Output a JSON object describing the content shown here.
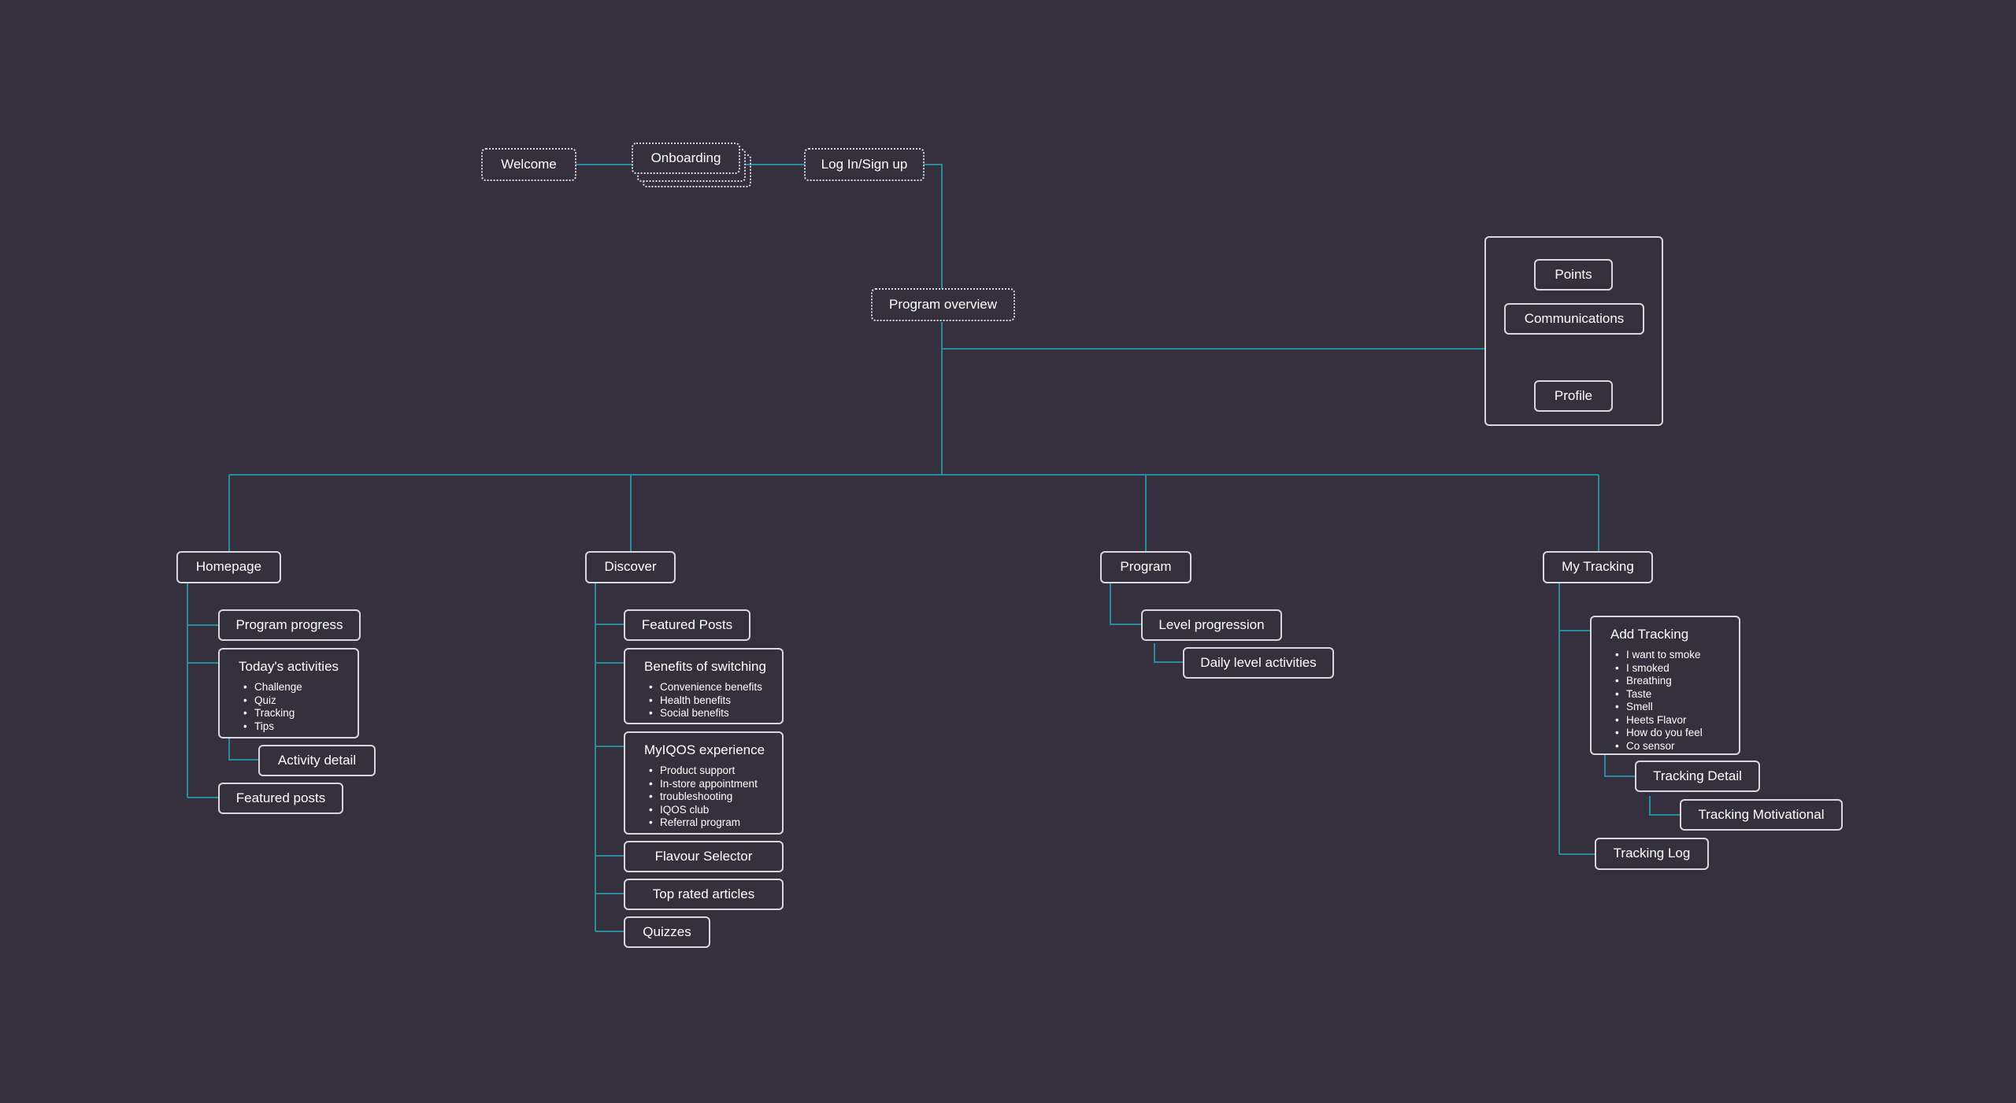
{
  "colors": {
    "background": "#35303d",
    "connector": "#2b8a9e",
    "node_border": "#dad6df",
    "text": "#ffffff"
  },
  "flow": {
    "welcome": "Welcome",
    "onboarding": "Onboarding",
    "login": "Log In/Sign up",
    "program_overview": "Program overview"
  },
  "global": {
    "points": "Points",
    "communications": "Communications",
    "profile": "Profile"
  },
  "homepage": {
    "title": "Homepage",
    "program_progress": "Program progress",
    "todays_activities": {
      "title": "Today's activities",
      "items": [
        "Challenge",
        "Quiz",
        "Tracking",
        "Tips"
      ]
    },
    "activity_detail": "Activity detail",
    "featured_posts": "Featured posts"
  },
  "discover": {
    "title": "Discover",
    "featured_posts": "Featured Posts",
    "benefits": {
      "title": "Benefits of switching",
      "items": [
        "Convenience benefits",
        "Health benefits",
        "Social benefits"
      ]
    },
    "myiqos": {
      "title": "MyIQOS experience",
      "items": [
        "Product support",
        "In-store appointment",
        "troubleshooting",
        "IQOS club",
        "Referral program"
      ]
    },
    "flavour_selector": "Flavour Selector",
    "top_rated": "Top rated articles",
    "quizzes": "Quizzes"
  },
  "program": {
    "title": "Program",
    "level_progression": "Level progression",
    "daily_level_activities": "Daily level activities"
  },
  "tracking": {
    "title": "My Tracking",
    "add_tracking": {
      "title": "Add Tracking",
      "items": [
        "I want to smoke",
        "I smoked",
        "Breathing",
        "Taste",
        "Smell",
        "Heets Flavor",
        "How do you feel",
        "Co sensor"
      ]
    },
    "tracking_detail": "Tracking Detail",
    "tracking_motivational": "Tracking Motivational",
    "tracking_log": "Tracking Log"
  }
}
